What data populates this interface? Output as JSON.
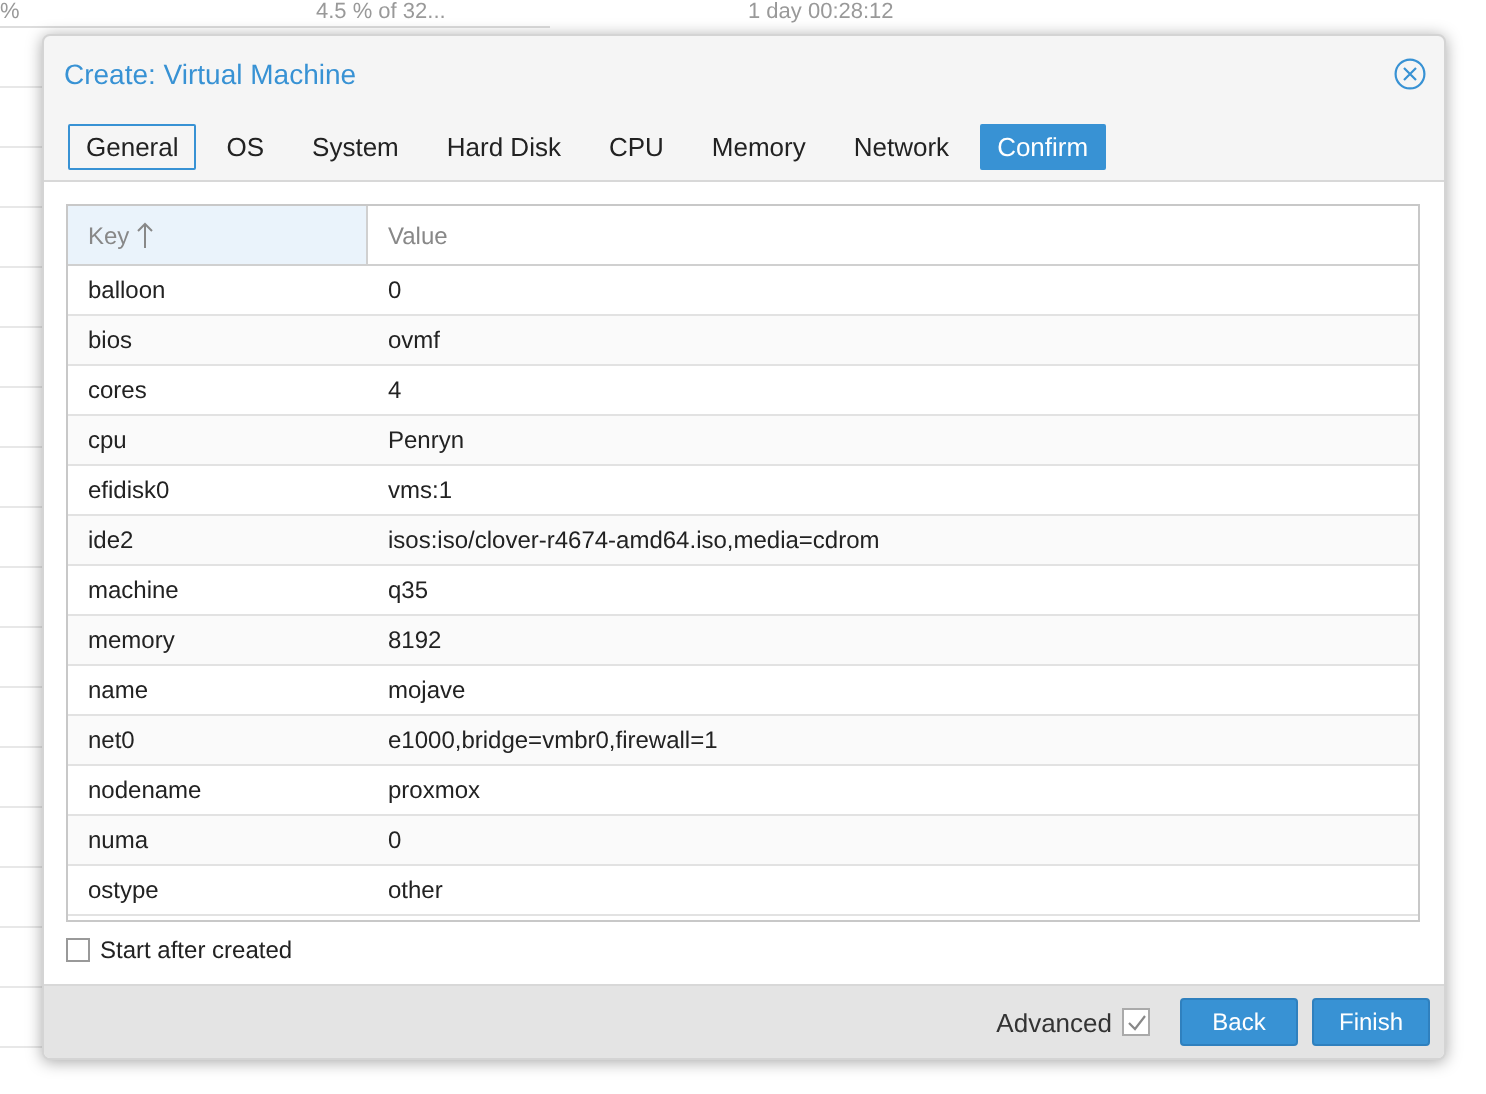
{
  "background": {
    "cells": [
      "%",
      "4.5 % of 32...",
      "1 day 00:28:12"
    ]
  },
  "window": {
    "title": "Create: Virtual Machine"
  },
  "tabs": [
    {
      "label": "General",
      "selected": false,
      "focused": true
    },
    {
      "label": "OS",
      "selected": false,
      "focused": false
    },
    {
      "label": "System",
      "selected": false,
      "focused": false
    },
    {
      "label": "Hard Disk",
      "selected": false,
      "focused": false
    },
    {
      "label": "CPU",
      "selected": false,
      "focused": false
    },
    {
      "label": "Memory",
      "selected": false,
      "focused": false
    },
    {
      "label": "Network",
      "selected": false,
      "focused": false
    },
    {
      "label": "Confirm",
      "selected": true,
      "focused": false
    }
  ],
  "table": {
    "columns": [
      {
        "label": "Key",
        "sorted": true
      },
      {
        "label": "Value",
        "sorted": false
      }
    ],
    "rows": [
      [
        "balloon",
        "0"
      ],
      [
        "bios",
        "ovmf"
      ],
      [
        "cores",
        "4"
      ],
      [
        "cpu",
        "Penryn"
      ],
      [
        "efidisk0",
        "vms:1"
      ],
      [
        "ide2",
        "isos:iso/clover-r4674-amd64.iso,media=cdrom"
      ],
      [
        "machine",
        "q35"
      ],
      [
        "memory",
        "8192"
      ],
      [
        "name",
        "mojave"
      ],
      [
        "net0",
        "e1000,bridge=vmbr0,firewall=1"
      ],
      [
        "nodename",
        "proxmox"
      ],
      [
        "numa",
        "0"
      ],
      [
        "ostype",
        "other"
      ]
    ]
  },
  "start_after_created": {
    "label": "Start after created",
    "checked": false
  },
  "footer": {
    "advanced": {
      "label": "Advanced",
      "checked": true
    },
    "buttons": [
      "Back",
      "Finish"
    ]
  }
}
